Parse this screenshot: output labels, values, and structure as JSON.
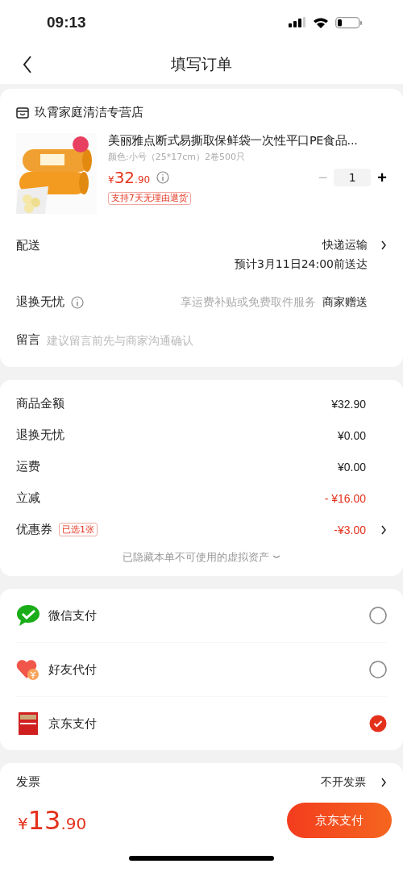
{
  "status_bar": {
    "time": "09:13"
  },
  "nav": {
    "title": "填写订单"
  },
  "store": {
    "name": "玖霄家庭清洁专营店"
  },
  "product": {
    "title": "美丽雅点断式易撕取保鲜袋一次性平口PE食品...",
    "spec": "颜色:小号（25*17cm）2卷500只",
    "price": {
      "symbol": "¥",
      "integer": "32",
      "decimal": ".90"
    },
    "quantity": "1",
    "minus": "−",
    "plus": "+",
    "tag": "支持7天无理由退货"
  },
  "delivery": {
    "label": "配送",
    "method": "快递运输",
    "eta": "预计3月11日24:00前送达"
  },
  "return_service": {
    "label": "退换无忧",
    "note": "享运费补贴或免费取件服务",
    "value": "商家赠送"
  },
  "message": {
    "label": "留言",
    "placeholder": "建议留言前先与商家沟通确认"
  },
  "summary": [
    {
      "label": "商品金额",
      "value": "¥32.90",
      "kind": "normal"
    },
    {
      "label": "退换无忧",
      "value": "¥0.00",
      "kind": "normal"
    },
    {
      "label": "运费",
      "value": "¥0.00",
      "kind": "normal"
    },
    {
      "label": "立减",
      "value": "- ¥16.00",
      "kind": "discount"
    },
    {
      "label": "优惠券",
      "badge": "已选1张",
      "value": "-¥3.00",
      "kind": "coupon"
    }
  ],
  "hidden_assets": "已隐藏本单不可使用的虚拟资产",
  "payments": [
    {
      "name": "微信支付",
      "kind": "wechat",
      "selected": false
    },
    {
      "name": "好友代付",
      "kind": "friend",
      "selected": false
    },
    {
      "name": "京东支付",
      "kind": "jdpay",
      "selected": true
    }
  ],
  "invoice": {
    "label": "发票",
    "value": "不开发票"
  },
  "bottom_bar": {
    "total": {
      "symbol": "¥",
      "integer": "13",
      "decimal": ".90"
    },
    "pay_button": "京东支付"
  }
}
